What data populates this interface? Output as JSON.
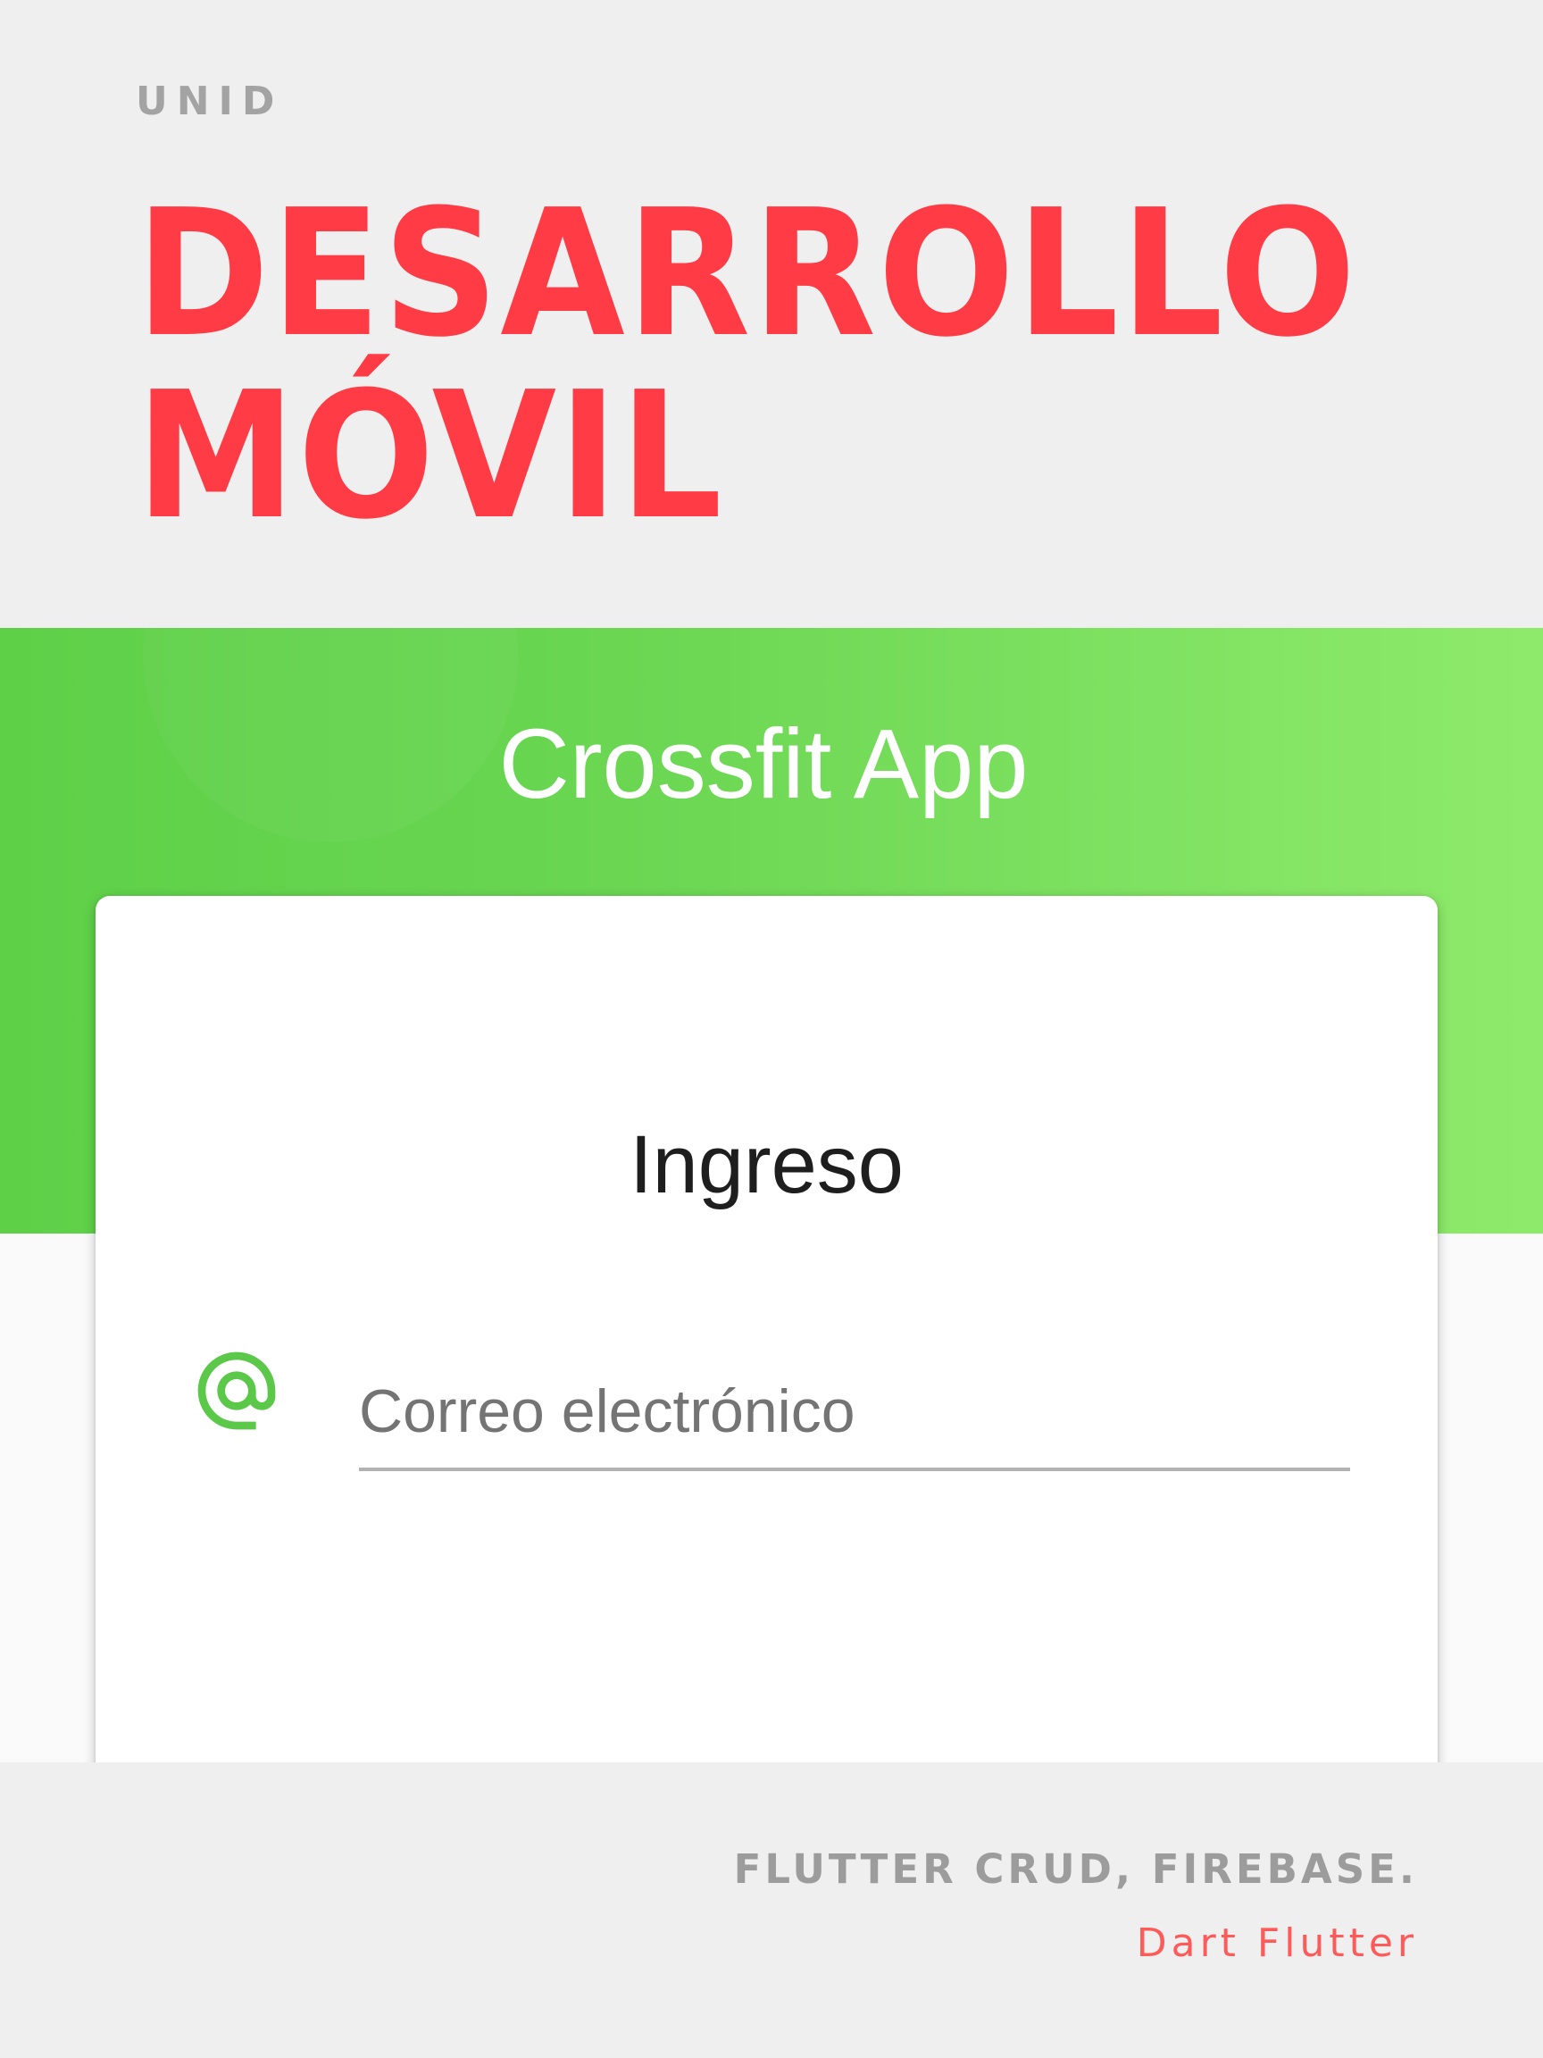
{
  "header": {
    "org": "UNID",
    "title_line1": "DESARROLLO",
    "title_line2": "MÓVIL"
  },
  "app": {
    "title": "Crossfit App",
    "login_card": {
      "heading": "Ingreso",
      "email_placeholder": "Correo electrónico",
      "email_icon": "at-sign-icon"
    }
  },
  "footer": {
    "subtitle": "FLUTTER CRUD, FIREBASE.",
    "tag": "Dart Flutter"
  },
  "colors": {
    "title_red": "#ff3b45",
    "banner_green": "#6ad652",
    "icon_green": "#5cc84a",
    "tag_red": "#ff5a5a"
  }
}
